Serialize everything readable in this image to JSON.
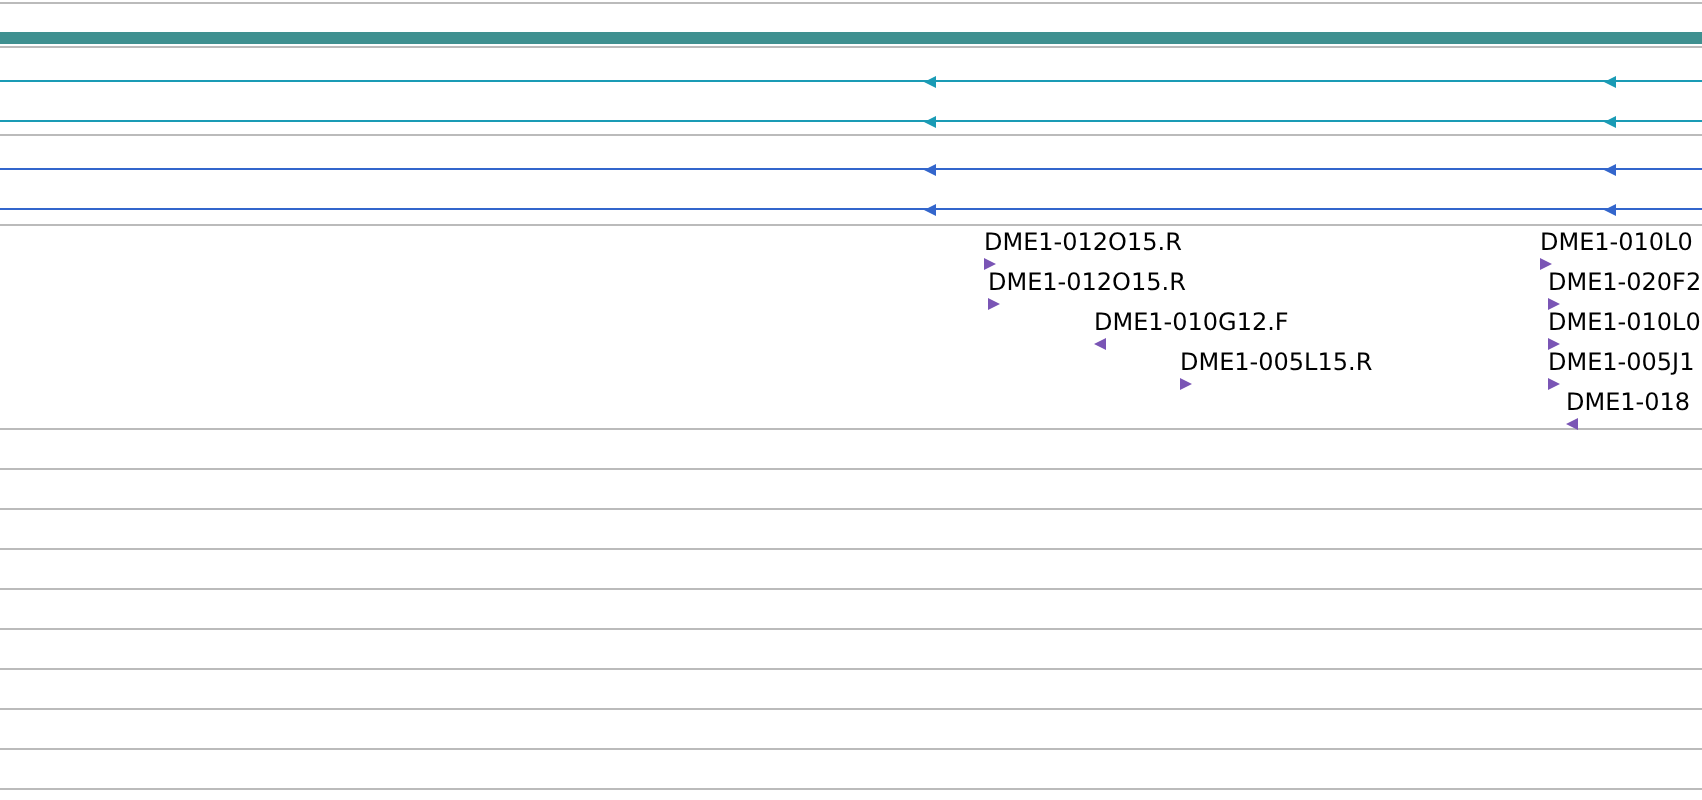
{
  "alignment_tracks": [
    {
      "color": "#1a9bb5",
      "reverse": true
    },
    {
      "color": "#1a9bb5",
      "reverse": true
    },
    {
      "color": "#3366cc",
      "reverse": true
    },
    {
      "color": "#3366cc",
      "reverse": true
    }
  ],
  "features": [
    {
      "label": "DME1-012O15.R",
      "reverse": false
    },
    {
      "label": "DME1-012O15.R",
      "reverse": false
    },
    {
      "label": "DME1-010G12.F",
      "reverse": true
    },
    {
      "label": "DME1-005L15.R",
      "reverse": false
    },
    {
      "label": "DME1-010L0",
      "reverse": false
    },
    {
      "label": "DME1-020F2",
      "reverse": false
    },
    {
      "label": "DME1-010L0",
      "reverse": false
    },
    {
      "label": "DME1-005J1",
      "reverse": false
    },
    {
      "label": "DME1-018",
      "reverse": true
    }
  ]
}
